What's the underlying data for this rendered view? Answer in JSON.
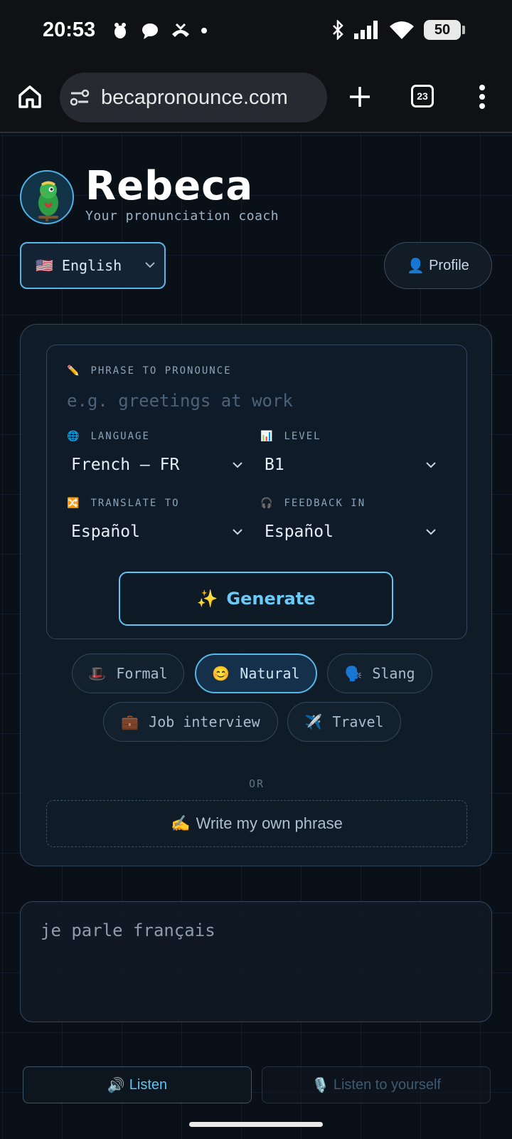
{
  "status_bar": {
    "time": "20:53",
    "battery": "50"
  },
  "browser": {
    "url": "becapronounce.com",
    "tab_count": "23"
  },
  "brand": {
    "name": "Rebeca",
    "tagline": "Your pronunciation coach"
  },
  "header": {
    "language_flag": "🇺🇸",
    "language": "English",
    "profile_icon": "👤",
    "profile_label": "Profile"
  },
  "form": {
    "phrase_icon": "✏️",
    "phrase_label": "PHRASE TO PRONOUNCE",
    "phrase_placeholder": "e.g. greetings at work",
    "phrase_value": "",
    "language_icon": "🌐",
    "language_label": "LANGUAGE",
    "language_value": "French — FR",
    "level_icon": "📊",
    "level_label": "LEVEL",
    "level_value": "B1",
    "translate_icon": "🔀",
    "translate_label": "TRANSLATE TO",
    "translate_value": "Español",
    "feedback_icon": "🎧",
    "feedback_label": "FEEDBACK IN",
    "feedback_value": "Español",
    "generate_icon": "✨",
    "generate_label": "Generate"
  },
  "styles": [
    {
      "icon": "🎩",
      "label": "Formal",
      "active": false
    },
    {
      "icon": "😊",
      "label": "Natural",
      "active": true
    },
    {
      "icon": "🗣️",
      "label": "Slang",
      "active": false
    },
    {
      "icon": "💼",
      "label": "Job interview",
      "active": false
    },
    {
      "icon": "✈️",
      "label": "Travel",
      "active": false
    }
  ],
  "or_label": "OR",
  "own_phrase": {
    "icon": "✍️",
    "label": "Write my own phrase"
  },
  "output": {
    "text": "je parle français"
  },
  "actions": {
    "listen_icon": "🔊",
    "listen_label": "Listen",
    "self_icon": "🎙️",
    "self_label": "Listen to yourself"
  },
  "colors": {
    "accent": "#5ec4f2",
    "background": "#0a1018",
    "card": "#121e2c"
  }
}
